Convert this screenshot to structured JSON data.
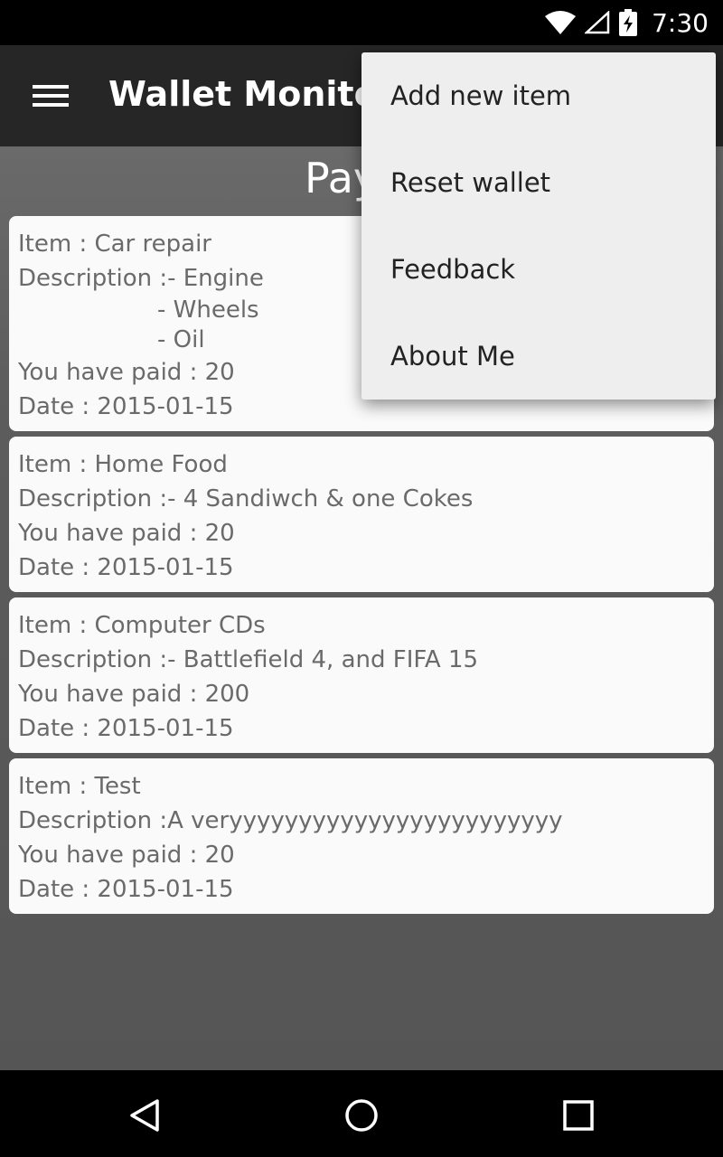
{
  "status_bar": {
    "time": "7:30",
    "icons": [
      "wifi-icon",
      "signal-icon",
      "battery-charging-icon"
    ]
  },
  "app_bar": {
    "title": "Wallet Monitor",
    "menu_icon": "hamburger-menu-icon"
  },
  "page": {
    "heading": "Paym"
  },
  "cards": [
    {
      "item": "Item : Car repair",
      "description": "Description :- Engine",
      "description_extra": [
        "- Wheels",
        "- Oil"
      ],
      "paid": "You have paid : 20",
      "date": "Date : 2015-01-15"
    },
    {
      "item": "Item : Home Food",
      "description": "Description :- 4 Sandiwch & one Cokes",
      "paid": "You have paid : 20",
      "date": "Date : 2015-01-15"
    },
    {
      "item": "Item : Computer CDs",
      "description": "Description :- Battlefield 4, and FIFA 15",
      "paid": "You have paid : 200",
      "date": "Date : 2015-01-15"
    },
    {
      "item": "Item : Test",
      "description": "Description :A veryyyyyyyyyyyyyyyyyyyyyyyy",
      "paid": "You have paid : 20",
      "date": "Date : 2015-01-15"
    }
  ],
  "overflow_menu": {
    "items": [
      "Add new item",
      "Reset wallet",
      "Feedback",
      "About Me"
    ]
  },
  "nav_bar": {
    "icons": [
      "back-icon",
      "home-icon",
      "recents-icon"
    ]
  },
  "colors": {
    "app_bar": "#262626",
    "card": "#fafafa",
    "menu": "#eeeeee",
    "card_text": "#6a6a6a"
  }
}
